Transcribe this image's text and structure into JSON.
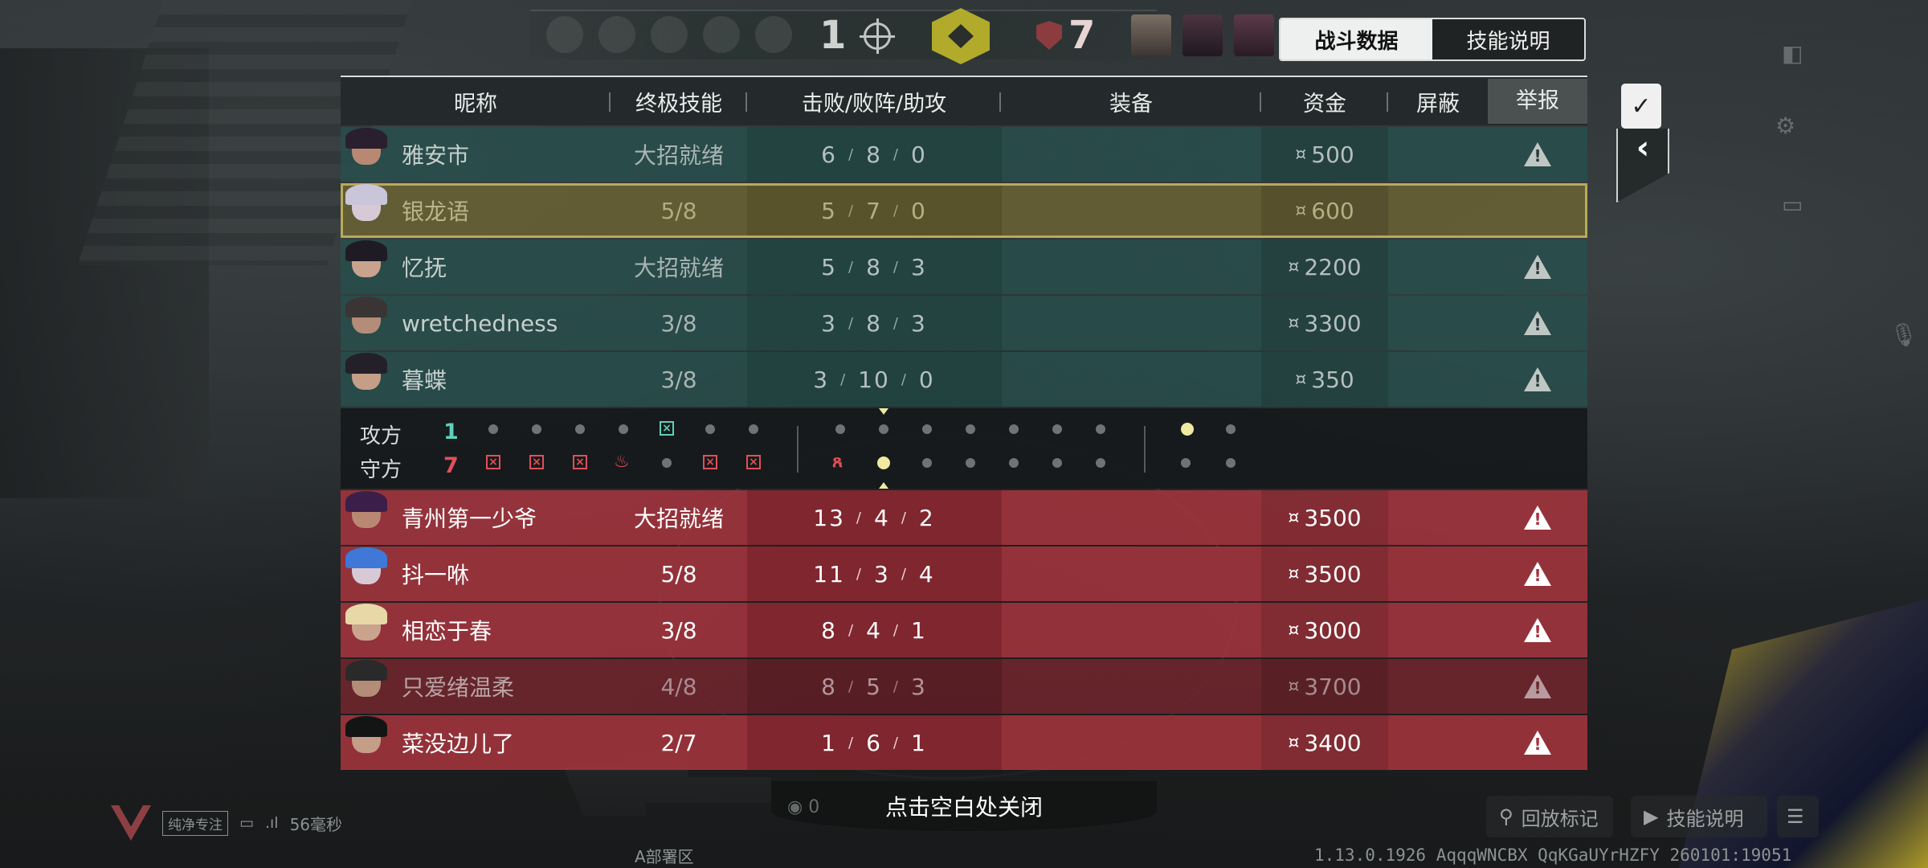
{
  "top_bar": {
    "ally_score": "1",
    "enemy_score": "7"
  },
  "tabs": [
    {
      "label": "战斗数据",
      "active": true
    },
    {
      "label": "技能说明",
      "active": false
    }
  ],
  "table": {
    "headers": {
      "name": "昵称",
      "ult": "终极技能",
      "kda": "击败/败阵/助攻",
      "equipment": "装备",
      "credits": "资金",
      "mute": "屏蔽",
      "report": "举报"
    },
    "credit_symbol": "¤",
    "allies": [
      {
        "name": "雅安市",
        "ult": "大招就绪",
        "k": "6",
        "d": "8",
        "a": "0",
        "credits": "500",
        "reportable": true,
        "self": false
      },
      {
        "name": "银龙语",
        "ult": "5/8",
        "k": "5",
        "d": "7",
        "a": "0",
        "credits": "600",
        "reportable": false,
        "self": true
      },
      {
        "name": "忆抚",
        "ult": "大招就绪",
        "k": "5",
        "d": "8",
        "a": "3",
        "credits": "2200",
        "reportable": true,
        "self": false
      },
      {
        "name": "wretchedness",
        "ult": "3/8",
        "k": "3",
        "d": "8",
        "a": "3",
        "credits": "3300",
        "reportable": true,
        "self": false
      },
      {
        "name": "暮蝶",
        "ult": "3/8",
        "k": "3",
        "d": "10",
        "a": "0",
        "credits": "350",
        "reportable": true,
        "self": false
      }
    ],
    "enemies": [
      {
        "name": "青州第一少爷",
        "ult": "大招就绪",
        "k": "13",
        "d": "4",
        "a": "2",
        "credits": "3500",
        "dim": false
      },
      {
        "name": "抖一咻",
        "ult": "5/8",
        "k": "11",
        "d": "3",
        "a": "4",
        "credits": "3500",
        "dim": false
      },
      {
        "name": "相恋于春",
        "ult": "3/8",
        "k": "8",
        "d": "4",
        "a": "1",
        "credits": "3000",
        "dim": false
      },
      {
        "name": "只爱绪温柔",
        "ult": "4/8",
        "k": "8",
        "d": "5",
        "a": "3",
        "credits": "3700",
        "dim": true
      },
      {
        "name": "菜没边儿了",
        "ult": "2/7",
        "k": "1",
        "d": "6",
        "a": "1",
        "credits": "3400",
        "dim": false
      }
    ]
  },
  "timeline": {
    "attack_label": "攻方",
    "defend_label": "守方",
    "attack_score": "1",
    "defend_score": "7"
  },
  "colors": {
    "ally_accent": "#5fd1b8",
    "enemy_accent": "#e05058",
    "self_accent": "#b9a95a"
  },
  "footer": {
    "close_hint": "点击空白处关闭",
    "spectate_count": "0",
    "pure_mode": "纯净专注",
    "ping": "56毫秒",
    "site": "A部署区",
    "replay_marker": "回放标记",
    "skill_desc": "技能说明",
    "version": "1.13.0.1926 AqqqWNCBX QqKGaUYrHZFY 260101:19051"
  }
}
